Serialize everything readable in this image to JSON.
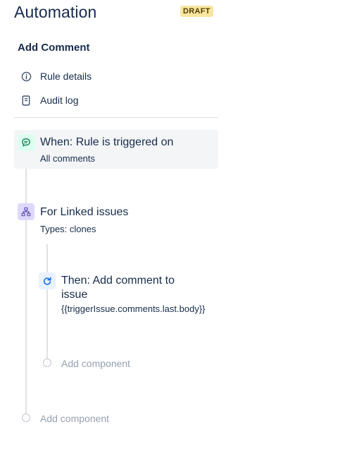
{
  "header": {
    "title": "Automation",
    "badge": "DRAFT"
  },
  "rule": {
    "name": "Add Comment"
  },
  "nav": {
    "rule_details": "Rule details",
    "audit_log": "Audit log"
  },
  "trigger": {
    "title": "When: Rule is triggered on",
    "subtitle": "All comments",
    "icon": "comment-icon",
    "color": "#1f845a"
  },
  "branch": {
    "title": "For Linked issues",
    "subtitle": "Types: clones",
    "icon": "branch-icon",
    "color": "#6e5dc6"
  },
  "action": {
    "title_line1": "Then: Add comment to",
    "title_line2": "issue",
    "subtitle": "{{triggerIssue.comments.last.body}}",
    "icon": "refresh-icon",
    "color": "#0c66e4"
  },
  "add_component": {
    "inner_label": "Add component",
    "outer_label": "Add component"
  }
}
